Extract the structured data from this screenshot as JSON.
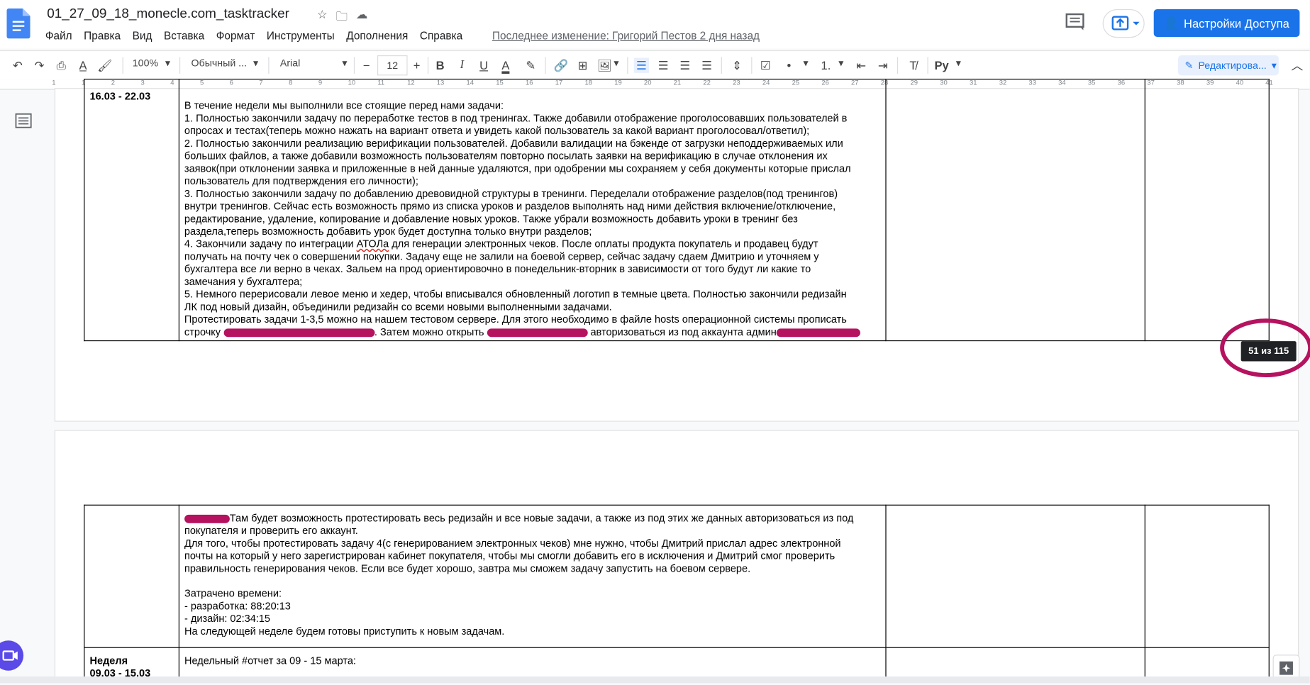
{
  "doc": {
    "title": "01_27_09_18_monecle.com_tasktracker",
    "last_edit": "Последнее изменение: Григорий Пестов 2 дня назад"
  },
  "menu": [
    "Файл",
    "Правка",
    "Вид",
    "Вставка",
    "Формат",
    "Инструменты",
    "Дополнения",
    "Справка"
  ],
  "share_label": "Настройки Доступа",
  "toolbar": {
    "zoom": "100%",
    "style": "Обычный ...",
    "font": "Arial",
    "font_size": "12",
    "edit_mode": "Редактирова..."
  },
  "ruler_marks": [
    "1",
    "1",
    "2",
    "3",
    "4",
    "5",
    "6",
    "7",
    "8",
    "9",
    "10",
    "11",
    "12",
    "13",
    "14",
    "15",
    "16",
    "17",
    "18",
    "19",
    "20",
    "21",
    "22",
    "23",
    "24",
    "25",
    "26",
    "27",
    "28",
    "29",
    "30",
    "31",
    "32",
    "33",
    "34",
    "35",
    "36",
    "37",
    "38",
    "39",
    "40",
    "41"
  ],
  "page1": {
    "date_label": "16.03 - 22.03",
    "lines": [
      "В течение недели мы выполнили все стоящие перед нами задачи:",
      "1. Полностью закончили задачу по переработке тестов в под тренингах. Также добавили отображение проголосовавших пользователей в",
      "опросах и тестах(теперь можно нажать на вариант ответа и увидеть какой пользователь за какой вариант проголосовал/ответил);",
      "2. Полностью закончили реализацию верификации пользователей. Добавили валидации на бэкенде от загрузки неподдерживаемых или",
      "больших файлов, а также добавили возможность пользователям повторно посылать заявки на верификацию в случае отклонения их",
      "заявок(при отклонении заявка и приложенные в ней данные удаляются, при одобрении мы сохраняем у себя документы которые прислал",
      "пользователь для подтверждения его личности);",
      "3. Полностью закончили задачу по добавлению древовидной структуры в тренинги. Переделали отображение разделов(под тренингов)",
      "внутри тренингов. Сейчас есть возможность прямо из списка уроков и разделов выполнять над ними действия включение/отключение,",
      "редактирование, удаление, копирование и добавление новых уроков. Также убрали возможность добавить уроки в тренинг без",
      "раздела,теперь возможность добавить урок будет доступна только внутри разделов;"
    ],
    "line4_a": "4. Закончили задачу по интеграции ",
    "line4_spell": "АТОЛа",
    "line4_b": " для генерации электронных чеков. После оплаты продукта покупатель и продавец будут",
    "lines2": [
      "получать на почту чек о совершении покупки. Задачу еще не залили на боевой сервер, сейчас задачу сдаем Дмитрию и уточняем у",
      "бухгалтера все ли верно в чеках. Зальем на прод ориентировочно в понедельник-вторник в зависимости от того будут ли какие то",
      "замечания у бухгалтера;",
      "5. Немного перерисовали левое меню и хедер, чтобы вписывался обновленный логотип в темные цвета. Полностью закончили редизайн",
      "ЛК под новый дизайн, объединили редизайн со всеми новыми выполненными задачами.",
      "Протестировать задачи 1-3,5 можно на нашем тестовом сервере. Для этого необходимо в файле hosts операционной системы прописать"
    ],
    "last_a": "строчку ",
    "last_b": ". Затем можно открыть ",
    "last_c": " авторизоваться из под аккаунта админ"
  },
  "counter": "51 из 115",
  "page2": {
    "first_line": "Там будет возможность протестировать весь редизайн и все новые задачи, а также из под этих же данных авторизоваться из под",
    "lines": [
      "покупателя и проверить его аккаунт.",
      "Для того, чтобы протестировать задачу 4(с генерированием электронных чеков) мне нужно, чтобы Дмитрий прислал адрес электронной",
      "почты на который у него зарегистрирован кабинет покупателя, чтобы мы смогли добавить его в исключения и Дмитрий смог проверить",
      "правильность генерирования чеков. Если все будет хорошо, завтра мы сможем задачу запустить на боевом сервере.",
      "",
      "Затрачено времени:",
      "- разработка: 88:20:13",
      "- дизайн: 02:34:15",
      "На следующей неделе будем готовы приступить к новым задачам."
    ],
    "week_label": "Неделя",
    "week_dates": "09.03 - 15.03",
    "weekly_report": "Недельный #отчет за 09 - 15 марта:"
  }
}
